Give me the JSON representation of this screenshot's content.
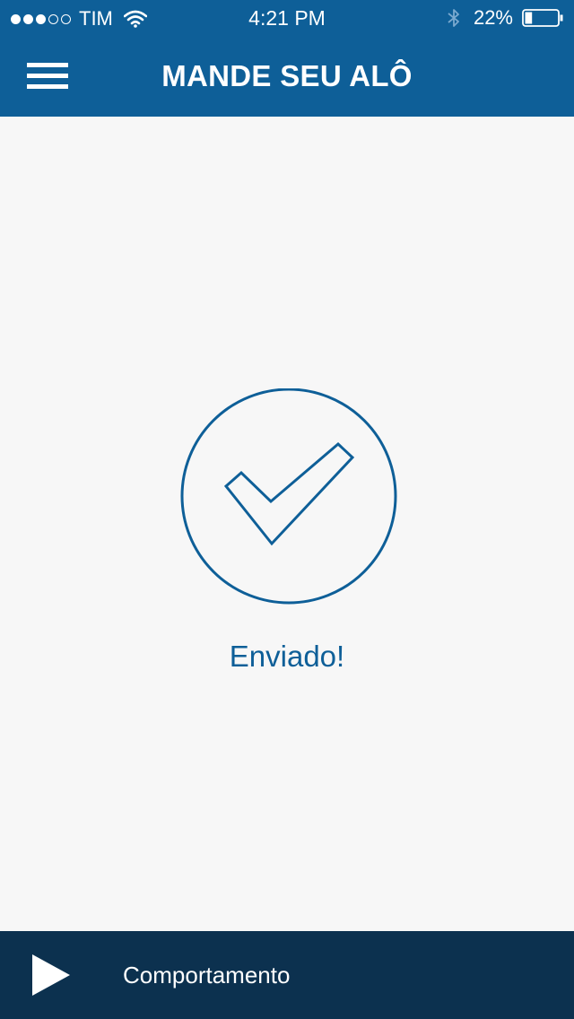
{
  "status_bar": {
    "signal_filled": 3,
    "signal_total": 5,
    "carrier": "TIM",
    "time": "4:21 PM",
    "battery_text": "22%",
    "battery_level": 0.22
  },
  "header": {
    "title": "MANDE SEU ALÔ"
  },
  "confirmation": {
    "message": "Enviado!",
    "accent_color": "#0e5f98"
  },
  "player": {
    "now_playing": "Comportamento"
  },
  "colors": {
    "header_bg": "#0e5f98",
    "page_bg": "#f7f7f7",
    "player_bg": "#0c314f"
  },
  "icons": {
    "menu": "hamburger-menu-icon",
    "success": "checkmark-circle-icon",
    "play": "play-icon"
  }
}
